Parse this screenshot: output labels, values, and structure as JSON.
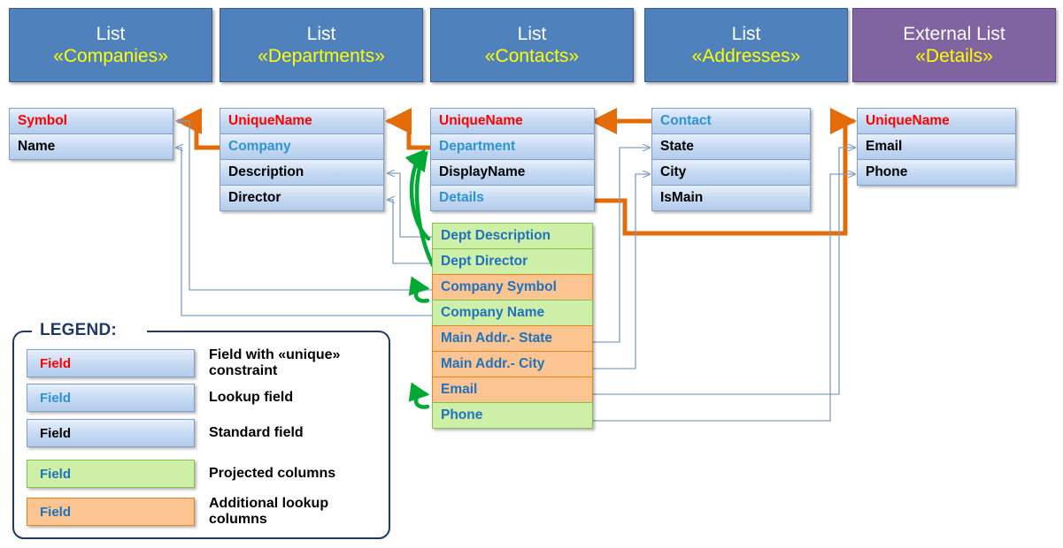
{
  "lists": [
    {
      "kind": "List",
      "stereotype": "«Companies»",
      "style": "blue",
      "fields": [
        {
          "label": "Symbol",
          "type": "unique"
        },
        {
          "label": "Name",
          "type": "standard"
        }
      ]
    },
    {
      "kind": "List",
      "stereotype": "«Departments»",
      "style": "blue",
      "fields": [
        {
          "label": "UniqueName",
          "type": "unique"
        },
        {
          "label": "Company",
          "type": "lookup"
        },
        {
          "label": "Description",
          "type": "standard"
        },
        {
          "label": "Director",
          "type": "standard"
        }
      ]
    },
    {
      "kind": "List",
      "stereotype": "«Contacts»",
      "style": "blue",
      "fields": [
        {
          "label": "UniqueName",
          "type": "unique"
        },
        {
          "label": "Department",
          "type": "lookup"
        },
        {
          "label": "DisplayName",
          "type": "standard"
        },
        {
          "label": "Details",
          "type": "lookup"
        }
      ]
    },
    {
      "kind": "List",
      "stereotype": "«Addresses»",
      "style": "blue",
      "fields": [
        {
          "label": "Contact",
          "type": "lookup"
        },
        {
          "label": "State",
          "type": "standard"
        },
        {
          "label": "City",
          "type": "standard"
        },
        {
          "label": "IsMain",
          "type": "standard"
        }
      ]
    },
    {
      "kind": "External List",
      "stereotype": "«Details»",
      "style": "purple",
      "fields": [
        {
          "label": "UniqueName",
          "type": "unique"
        },
        {
          "label": "Email",
          "type": "standard"
        },
        {
          "label": "Phone",
          "type": "standard"
        }
      ]
    }
  ],
  "projected_columns": [
    {
      "label": "Dept Description",
      "type": "projected"
    },
    {
      "label": "Dept Director",
      "type": "projected"
    },
    {
      "label": "Company Symbol",
      "type": "additional"
    },
    {
      "label": "Company Name",
      "type": "projected"
    },
    {
      "label": "Main Addr.- State",
      "type": "additional"
    },
    {
      "label": "Main Addr.- City",
      "type": "additional"
    },
    {
      "label": "Email",
      "type": "additional"
    },
    {
      "label": "Phone",
      "type": "projected"
    }
  ],
  "legend": {
    "title": "LEGEND:",
    "items": [
      {
        "sample": "Field",
        "description": "Field with «unique» constraint",
        "swatch": "blue",
        "text_color": "red"
      },
      {
        "sample": "Field",
        "description": "Lookup field",
        "swatch": "blue",
        "text_color": "blue"
      },
      {
        "sample": "Field",
        "description": "Standard field",
        "swatch": "blue",
        "text_color": "black"
      },
      {
        "sample": "Field",
        "description": "Projected columns",
        "swatch": "green",
        "text_color": "blue"
      },
      {
        "sample": "Field",
        "description": "Additional lookup columns",
        "swatch": "orange",
        "text_color": "blue"
      }
    ]
  },
  "colors": {
    "header_blue": "#4f81bd",
    "header_purple": "#8064a2",
    "stereotype_yellow": "#ffff00",
    "unique_red": "#ff0000",
    "lookup_blue": "#2e93d4",
    "projected_green": "#cdefa8",
    "additional_orange": "#fbc490",
    "lookup_arrow_blue": "#7f9fc4",
    "relation_orange": "#e36c09",
    "projection_green": "#00a933",
    "legend_border": "#1f3864"
  }
}
